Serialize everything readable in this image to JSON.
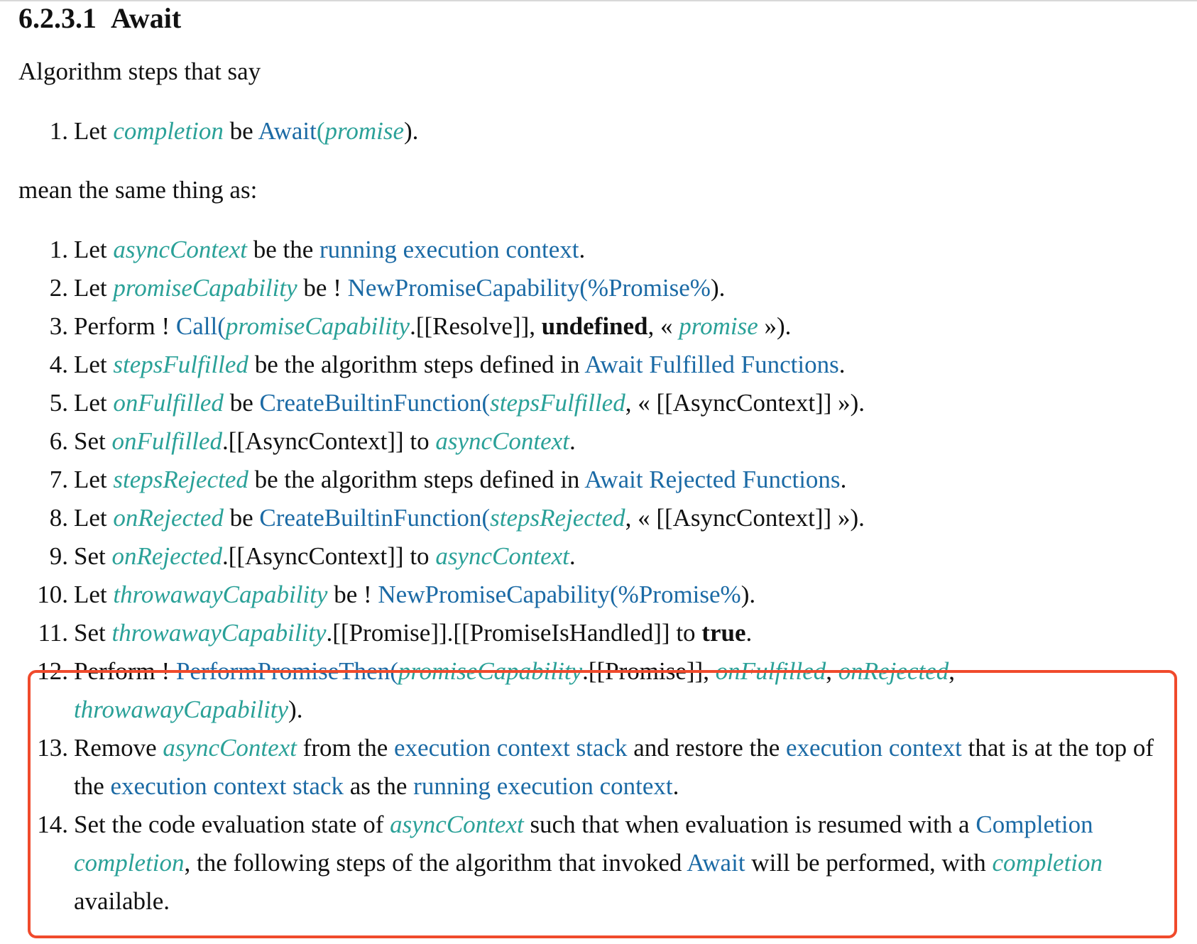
{
  "section": {
    "number": "6.2.3.1",
    "title": "Await"
  },
  "intro_text": "Algorithm steps that say",
  "short_steps": [
    {
      "num": "1.",
      "t0": "Let ",
      "v_completion": "completion",
      "t1": " be ",
      "l_await": "Await",
      "p_open": "(",
      "v_promise": "promise",
      "p_close": ")."
    }
  ],
  "mean_text": "mean the same thing as:",
  "steps": {
    "s1": {
      "num": "1.",
      "a": "Let ",
      "b": "asyncContext",
      "c": " be the ",
      "d": "running execution context",
      "e": "."
    },
    "s2": {
      "num": "2.",
      "a": "Let ",
      "b": "promiseCapability",
      "c": " be ! ",
      "d": "NewPromiseCapability",
      "e": "(",
      "f": "%Promise%",
      "g": ")."
    },
    "s3": {
      "num": "3.",
      "a": "Perform ! ",
      "b": "Call",
      "c": "(",
      "d": "promiseCapability",
      "e": ".[[Resolve]], ",
      "f": "undefined",
      "g": ", « ",
      "h": "promise",
      "i": " »)."
    },
    "s4": {
      "num": "4.",
      "a": "Let ",
      "b": "stepsFulfilled",
      "c": " be the algorithm steps defined in ",
      "d": "Await Fulfilled Functions",
      "e": "."
    },
    "s5": {
      "num": "5.",
      "a": "Let ",
      "b": "onFulfilled",
      "c": " be ",
      "d": "CreateBuiltinFunction",
      "e": "(",
      "f": "stepsFulfilled",
      "g": ", « [[AsyncContext]] »)."
    },
    "s6": {
      "num": "6.",
      "a": "Set ",
      "b": "onFulfilled",
      "c": ".[[AsyncContext]] to ",
      "d": "asyncContext",
      "e": "."
    },
    "s7": {
      "num": "7.",
      "a": "Let ",
      "b": "stepsRejected",
      "c": " be the algorithm steps defined in ",
      "d": "Await Rejected Functions",
      "e": "."
    },
    "s8": {
      "num": "8.",
      "a": "Let ",
      "b": "onRejected",
      "c": " be ",
      "d": "CreateBuiltinFunction",
      "e": "(",
      "f": "stepsRejected",
      "g": ", « [[AsyncContext]] »)."
    },
    "s9": {
      "num": "9.",
      "a": "Set ",
      "b": "onRejected",
      "c": ".[[AsyncContext]] to ",
      "d": "asyncContext",
      "e": "."
    },
    "s10": {
      "num": "10.",
      "a": "Let ",
      "b": "throwawayCapability",
      "c": " be ! ",
      "d": "NewPromiseCapability",
      "e": "(",
      "f": "%Promise%",
      "g": ")."
    },
    "s11": {
      "num": "11.",
      "a": "Set ",
      "b": "throwawayCapability",
      "c": ".[[Promise]].[[PromiseIsHandled]] to ",
      "d": "true",
      "e": "."
    },
    "s12": {
      "num": "12.",
      "a": "Perform ! ",
      "b": "PerformPromiseThen",
      "c": "(",
      "d": "promiseCapability",
      "e": ".[[Promise]], ",
      "f": "onFulfilled",
      "g": ", ",
      "h": "onRejected",
      "i": ", ",
      "j": "throwawayCapability",
      "k": ")."
    },
    "s13": {
      "num": "13.",
      "a": "Remove ",
      "b": "asyncContext",
      "c": " from the ",
      "d": "execution context stack",
      "e": " and restore the ",
      "f": "execution context",
      "g": " that is at the top of the ",
      "h": "execution context stack",
      "i": " as the ",
      "j": "running execution context",
      "k": "."
    },
    "s14": {
      "num": "14.",
      "a": "Set the code evaluation state of ",
      "b": "asyncContext",
      "c": " such that when evaluation is resumed with a ",
      "d": "Completion",
      "e": " ",
      "f": "completion",
      "g": ", the following steps of the algorithm that invoked ",
      "h": "Await",
      "i": " will be performed, with ",
      "j": "completion",
      "k": " available."
    }
  },
  "colors": {
    "link": "#1b6aa5",
    "variable": "#2aa198",
    "highlight_border": "#f04a2c"
  }
}
